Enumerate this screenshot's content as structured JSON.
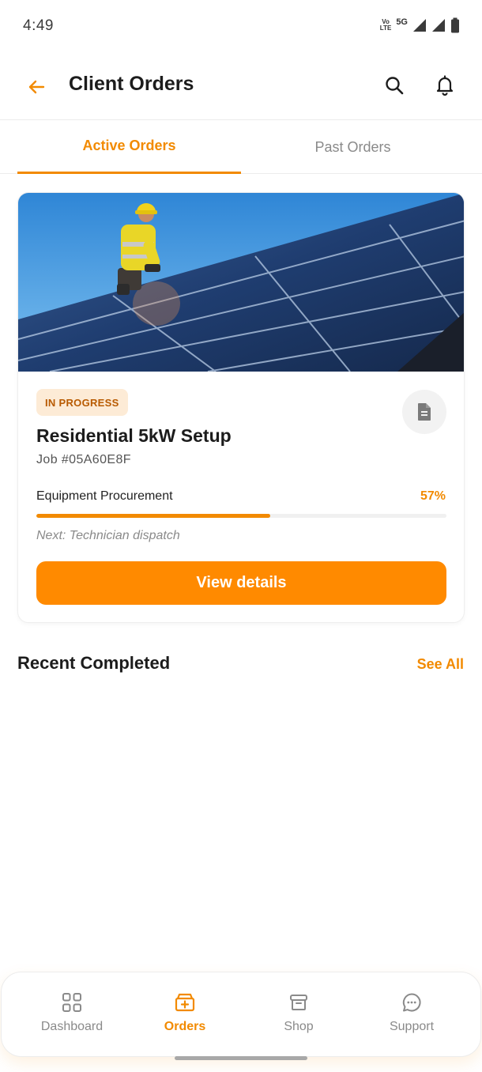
{
  "status_bar": {
    "time": "4:49",
    "volte_top": "Vo",
    "volte_bottom": "LTE",
    "network": "5G"
  },
  "app_bar": {
    "title": "Client Orders"
  },
  "tabs": [
    {
      "label": "Active Orders",
      "active": true
    },
    {
      "label": "Past Orders",
      "active": false
    }
  ],
  "order": {
    "status": "IN PROGRESS",
    "title": "Residential 5kW Setup",
    "job_id": "Job #05A60E8F",
    "stage": "Equipment Procurement",
    "progress_label": "57%",
    "progress": 0.57,
    "next": "Next: Technician dispatch",
    "action": "View details"
  },
  "recent": {
    "title": "Recent Completed",
    "see_all": "See All"
  },
  "bottom_nav": [
    {
      "label": "Dashboard",
      "icon": "grid-icon",
      "active": false
    },
    {
      "label": "Orders",
      "icon": "orders-box-icon",
      "active": true
    },
    {
      "label": "Shop",
      "icon": "shop-box-icon",
      "active": false
    },
    {
      "label": "Support",
      "icon": "chat-icon",
      "active": false
    }
  ],
  "colors": {
    "accent": "#f28a00",
    "button": "#ff8a00",
    "badge_bg": "#fdebd6"
  }
}
